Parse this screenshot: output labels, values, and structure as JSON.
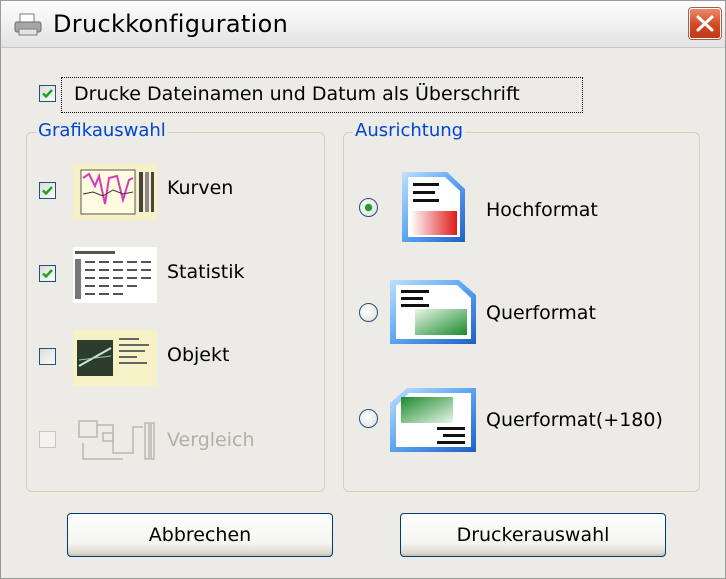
{
  "window": {
    "title": "Druckkonfiguration"
  },
  "header_option": {
    "label": "Drucke Dateinamen und Datum als Überschrift",
    "checked": true
  },
  "graphics_group": {
    "title": "Grafikauswahl",
    "items": [
      {
        "label": "Kurven",
        "checked": true,
        "enabled": true,
        "icon": "curve-chart-thumbnail-icon"
      },
      {
        "label": "Statistik",
        "checked": true,
        "enabled": true,
        "icon": "statistics-table-thumbnail-icon"
      },
      {
        "label": "Objekt",
        "checked": false,
        "enabled": true,
        "icon": "object-thumbnail-icon"
      },
      {
        "label": "Vergleich",
        "checked": false,
        "enabled": false,
        "icon": "comparison-thumbnail-icon"
      }
    ]
  },
  "orientation_group": {
    "title": "Ausrichtung",
    "options": [
      {
        "label": "Hochformat",
        "selected": true,
        "icon": "portrait-page-icon"
      },
      {
        "label": "Querformat",
        "selected": false,
        "icon": "landscape-page-icon"
      },
      {
        "label": "Querformat(+180)",
        "selected": false,
        "icon": "landscape-rotated-page-icon"
      }
    ]
  },
  "buttons": {
    "cancel": "Abbrechen",
    "printer_select": "Druckerauswahl"
  },
  "colors": {
    "group_title": "#0046d5",
    "check_mark": "#21a121",
    "close_button": "#d14a22"
  }
}
